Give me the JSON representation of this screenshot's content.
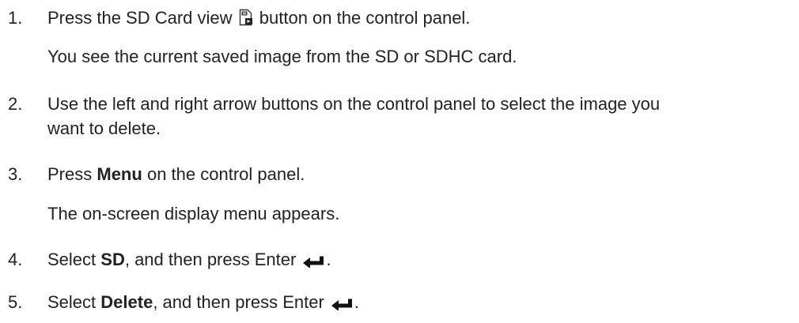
{
  "steps": [
    {
      "num": "1.",
      "pre": "Press the SD Card view",
      "icon": "sd-card-view-icon",
      "post": "button on the control panel.",
      "note": "You see the current saved image from the SD or SDHC card."
    },
    {
      "num": "2.",
      "line1": "Use the left and right arrow buttons on the control panel to select the image you",
      "line2": "want to delete."
    },
    {
      "num": "3.",
      "pre": "Press",
      "bold": "Menu",
      "post": "on the control panel.",
      "note": "The on-screen display menu appears."
    },
    {
      "num": "4.",
      "pre": "Select",
      "bold": "SD",
      "post": ", and then press Enter",
      "icon": "enter-arrow-icon",
      "end": "."
    },
    {
      "num": "5.",
      "pre": "Select",
      "bold": "Delete",
      "post": ", and then press Enter",
      "icon": "enter-arrow-icon",
      "end": "."
    }
  ]
}
